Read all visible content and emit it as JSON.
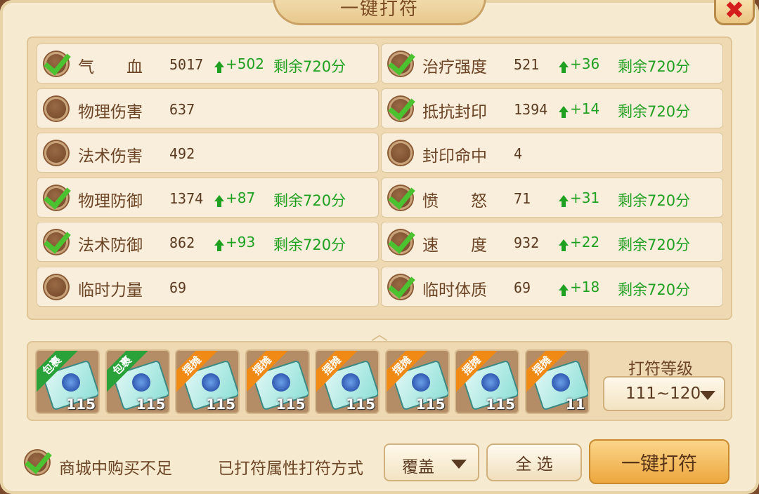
{
  "window": {
    "title": "一键打符",
    "close_label": "✖"
  },
  "stats_left": [
    {
      "name": "气　　血",
      "checked": true,
      "value": "5017",
      "increase": "+502",
      "remaining": "剩余720分"
    },
    {
      "name": "物理伤害",
      "checked": false,
      "value": "637",
      "increase": "",
      "remaining": ""
    },
    {
      "name": "法术伤害",
      "checked": false,
      "value": "492",
      "increase": "",
      "remaining": ""
    },
    {
      "name": "物理防御",
      "checked": true,
      "value": "1374",
      "increase": "+87",
      "remaining": "剩余720分"
    },
    {
      "name": "法术防御",
      "checked": true,
      "value": "862",
      "increase": "+93",
      "remaining": "剩余720分"
    },
    {
      "name": "临时力量",
      "checked": false,
      "value": "69",
      "increase": "",
      "remaining": ""
    }
  ],
  "stats_right": [
    {
      "name": "治疗强度",
      "checked": true,
      "value": "521",
      "increase": "+36",
      "remaining": "剩余720分"
    },
    {
      "name": "抵抗封印",
      "checked": true,
      "value": "1394",
      "increase": "+14",
      "remaining": "剩余720分"
    },
    {
      "name": "封印命中",
      "checked": false,
      "value": "4",
      "increase": "",
      "remaining": ""
    },
    {
      "name": "愤　　怒",
      "checked": true,
      "value": "71",
      "increase": "+31",
      "remaining": "剩余720分"
    },
    {
      "name": "速　　度",
      "checked": true,
      "value": "932",
      "increase": "+22",
      "remaining": "剩余720分"
    },
    {
      "name": "临时体质",
      "checked": true,
      "value": "69",
      "increase": "+18",
      "remaining": "剩余720分"
    }
  ],
  "items": [
    {
      "tag": "包裹",
      "tag_color": "#2aa23a",
      "level": "115"
    },
    {
      "tag": "包裹",
      "tag_color": "#2aa23a",
      "level": "115"
    },
    {
      "tag": "摆摊",
      "tag_color": "#f08a14",
      "level": "115"
    },
    {
      "tag": "摆摊",
      "tag_color": "#f08a14",
      "level": "115"
    },
    {
      "tag": "摆摊",
      "tag_color": "#f08a14",
      "level": "115"
    },
    {
      "tag": "摆摊",
      "tag_color": "#f08a14",
      "level": "115"
    },
    {
      "tag": "摆摊",
      "tag_color": "#f08a14",
      "level": "115"
    },
    {
      "tag": "摆摊",
      "tag_color": "#f08a14",
      "level": "11"
    }
  ],
  "grade": {
    "title": "打符等级",
    "selected": "111~120"
  },
  "footer": {
    "mall_checkbox_label": "商城中购买不足",
    "mall_checked": true,
    "mode_label": "已打符属性打符方式",
    "mode_selected": "覆盖",
    "select_all_label": "全 选",
    "action_label": "一键打符"
  }
}
